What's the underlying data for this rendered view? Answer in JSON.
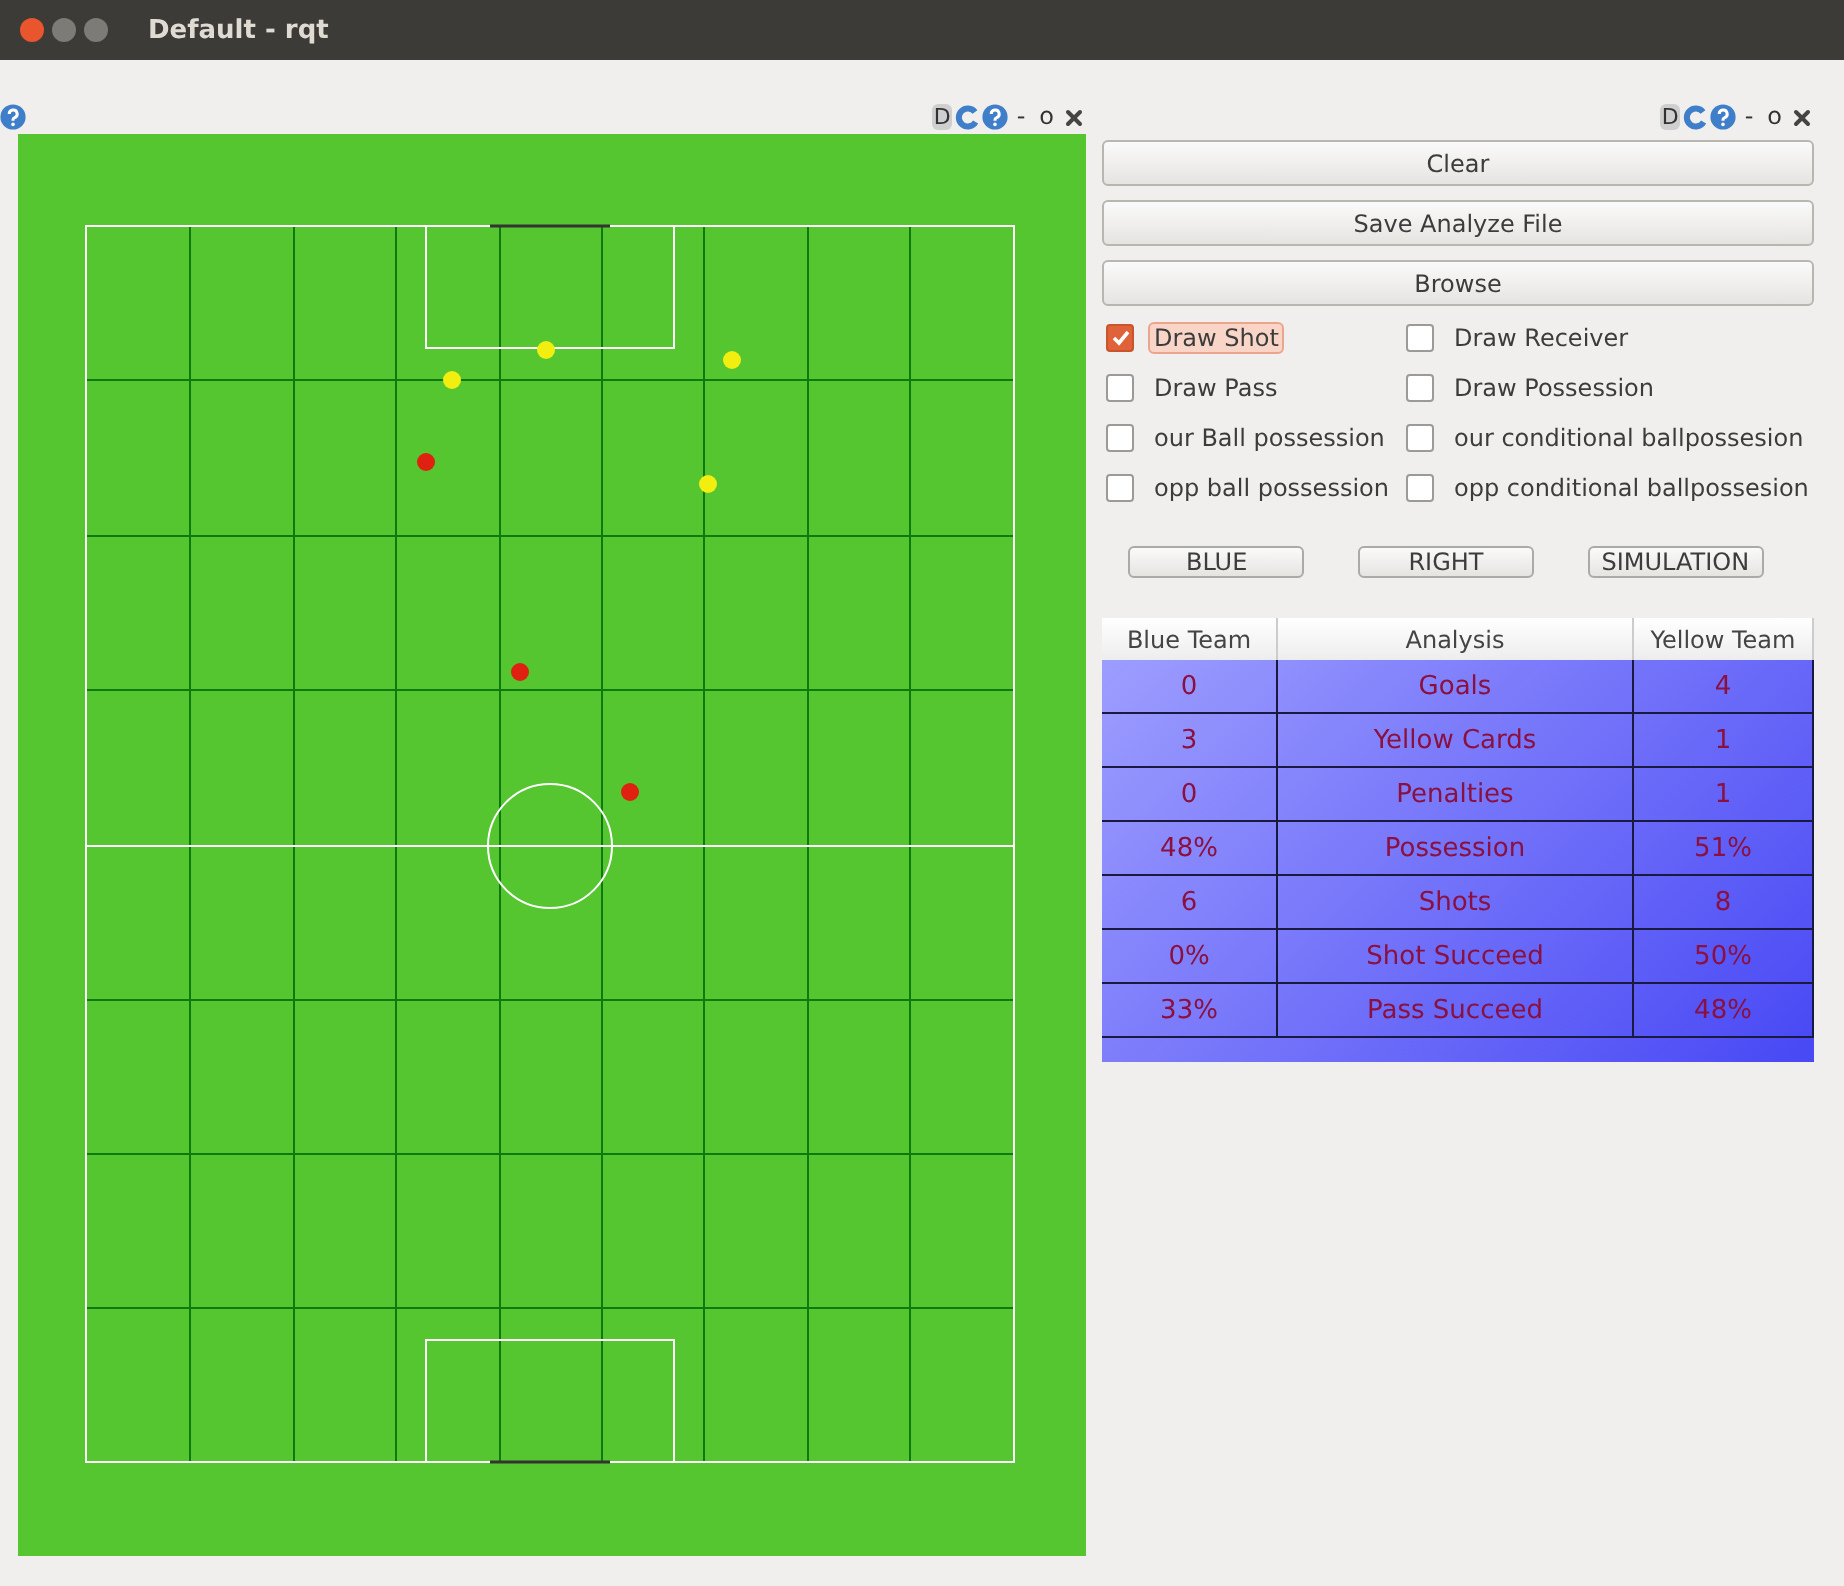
{
  "window": {
    "title": "Default - rqt"
  },
  "panes": [
    {
      "dock_label": "D",
      "minimize": "-",
      "float": "o"
    },
    {
      "dock_label": "D",
      "minimize": "-",
      "float": "o"
    }
  ],
  "buttons": [
    "Clear",
    "Save Analyze File",
    "Browse"
  ],
  "checkboxes": [
    {
      "label": "Draw Shot",
      "checked": true
    },
    {
      "label": "Draw Receiver",
      "checked": false
    },
    {
      "label": "Draw Pass",
      "checked": false
    },
    {
      "label": "Draw Possession",
      "checked": false
    },
    {
      "label": "our Ball possession",
      "checked": false
    },
    {
      "label": "our conditional ballpossesion",
      "checked": false
    },
    {
      "label": "opp ball possession",
      "checked": false
    },
    {
      "label": "opp conditional ballpossesion",
      "checked": false
    }
  ],
  "toggles": [
    "BLUE",
    "RIGHT",
    "SIMULATION"
  ],
  "table": {
    "columns": [
      "Blue Team",
      "Analysis",
      "Yellow Team"
    ],
    "rows": [
      [
        "0",
        "Goals",
        "4"
      ],
      [
        "3",
        "Yellow Cards",
        "1"
      ],
      [
        "0",
        "Penalties",
        "1"
      ],
      [
        "48%",
        "Possession",
        "51%"
      ],
      [
        "6",
        "Shots",
        "8"
      ],
      [
        "0%",
        "Shot Succeed",
        "50%"
      ],
      [
        "33%",
        "Pass Succeed",
        "48%"
      ]
    ]
  }
}
